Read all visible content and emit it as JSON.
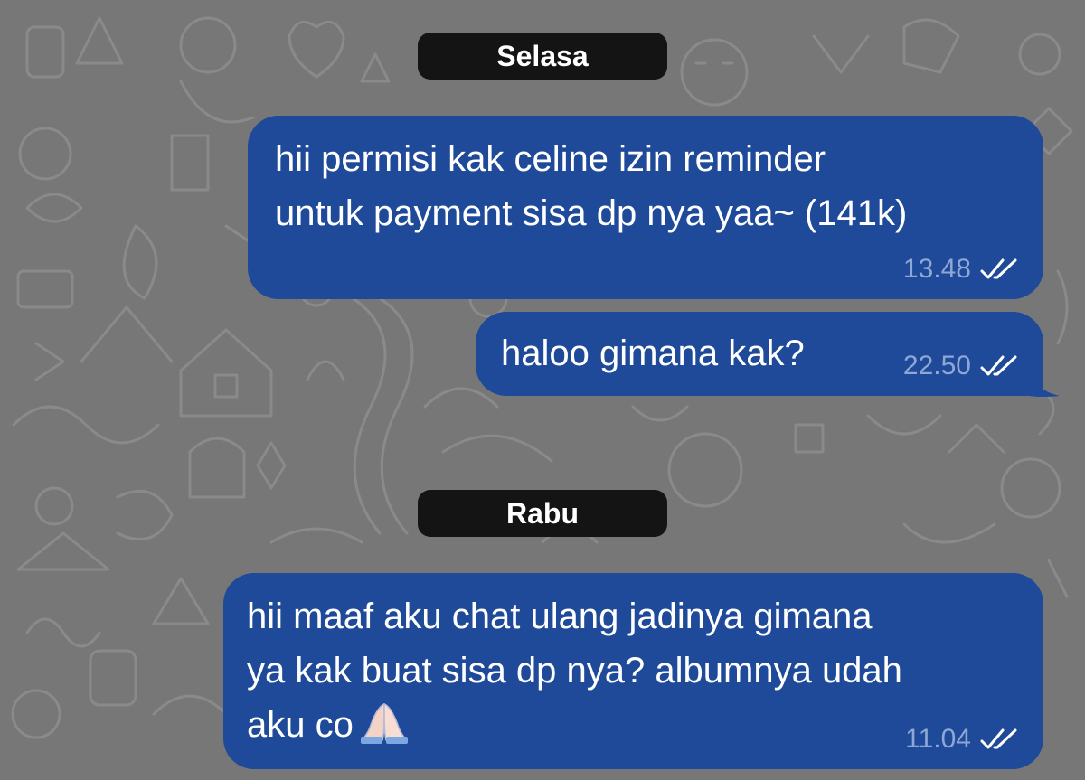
{
  "chat": {
    "days": [
      {
        "label": "Selasa"
      },
      {
        "label": "Rabu"
      }
    ],
    "messages": [
      {
        "text": "hii permisi kak celine izin reminder\nuntuk payment sisa dp nya yaa~ (141k)",
        "time": "13.48",
        "status": "read-double-check-icon"
      },
      {
        "text": "haloo gimana kak?",
        "time": "22.50",
        "status": "read-double-check-icon"
      },
      {
        "text": "hii maaf aku chat ulang jadinya gimana\nya kak buat sisa dp nya? albumnya udah\naku co",
        "emoji": "folded-hands-icon",
        "time": "11.04",
        "status": "read-double-check-icon"
      }
    ]
  },
  "colors": {
    "background": "#777777",
    "doodle": "#8c8c8c",
    "bubble_outgoing": "#1e4a99",
    "date_pill": "#141414",
    "meta_text": "#8fa7d4"
  }
}
